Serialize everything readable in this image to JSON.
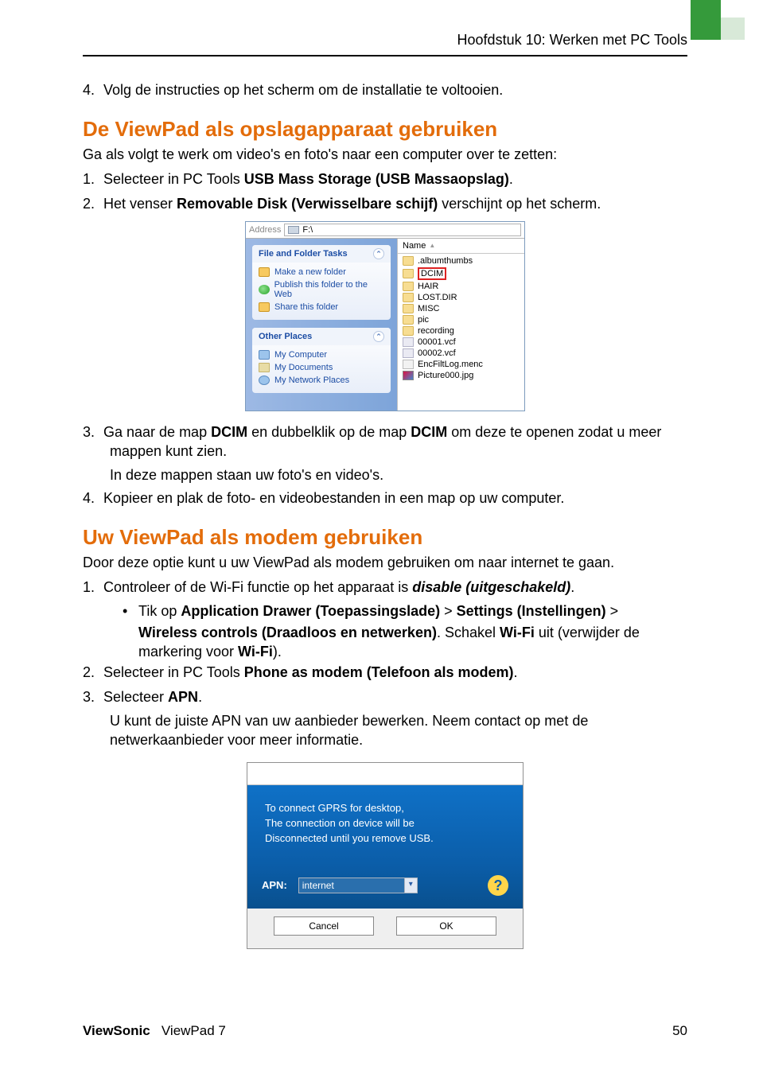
{
  "header": {
    "chapter": "Hoofdstuk 10: Werken met PC Tools"
  },
  "intro_step4": {
    "num": "4.",
    "text": "Volg de instructies op het scherm om de installatie te voltooien."
  },
  "sec1": {
    "title": "De ViewPad als opslagapparaat gebruiken",
    "lead": "Ga als volgt te werk om video's en foto's naar een computer over te zetten:",
    "step1": {
      "num": "1.",
      "pre": "Selecteer in PC Tools ",
      "bold": "USB Mass Storage (USB Massaopslag)",
      "post": "."
    },
    "step2": {
      "num": "2.",
      "pre": "Het venser ",
      "bold": "Removable Disk (Verwisselbare schijf)",
      "post": " verschijnt op het scherm."
    },
    "step3": {
      "num": "3.",
      "line_a": "Ga naar de map ",
      "b1": "DCIM",
      "mid": " en dubbelklik op de map ",
      "b2": "DCIM",
      "line_b": " om deze te openen zodat u meer mappen kunt zien.",
      "sub": "In deze mappen staan uw foto's en video's."
    },
    "step4": {
      "num": "4.",
      "text": "Kopieer en plak de foto- en videobestanden in een map op uw computer."
    }
  },
  "explorer": {
    "address_label": "Address",
    "drive": "F:\\",
    "tasks_title": "File and Folder Tasks",
    "tasks": [
      "Make a new folder",
      "Publish this folder to the Web",
      "Share this folder"
    ],
    "places_title": "Other Places",
    "places": [
      "My Computer",
      "My Documents",
      "My Network Places"
    ],
    "name_col": "Name",
    "files": [
      ".albumthumbs",
      "DCIM",
      "HAIR",
      "LOST.DIR",
      "MISC",
      "pic",
      "recording",
      "00001.vcf",
      "00002.vcf",
      "EncFiltLog.menc",
      "Picture000.jpg"
    ]
  },
  "sec2": {
    "title": "Uw ViewPad als modem gebruiken",
    "lead": "Door deze optie kunt u uw ViewPad als modem gebruiken om naar internet te gaan.",
    "step1": {
      "num": "1.",
      "line": "Controleer of de Wi-Fi functie op het apparaat is ",
      "disable": "disable (uitgeschakeld)",
      "post": ".",
      "b_pre": "Tik op ",
      "b_appdrawer": "Application Drawer (Toepassingslade)",
      "b_gt1": " > ",
      "b_settings": "Settings (Instellingen)",
      "b_gt2": " > ",
      "b_wireless": "Wireless controls (Draadloos en netwerken)",
      "b_mid": ". Schakel ",
      "b_wifi": "Wi-Fi",
      "b_mid2": " uit (verwijder de markering voor ",
      "b_wifi2": "Wi-Fi",
      "b_end": ")."
    },
    "step2": {
      "num": "2.",
      "pre": "Selecteer in PC Tools ",
      "bold": "Phone as modem (Telefoon als modem)",
      "post": "."
    },
    "step3": {
      "num": "3.",
      "pre": "Selecteer ",
      "bold": "APN",
      "post": ".",
      "sub": "U kunt de juiste APN van uw aanbieder bewerken. Neem contact op met de netwerkaanbieder voor meer informatie."
    }
  },
  "dialog": {
    "line1": "To connect GPRS for desktop,",
    "line2": "The connection on device will be",
    "line3": "Disconnected until you remove USB.",
    "apn_label": "APN:",
    "apn_value": "internet",
    "help": "?",
    "cancel": "Cancel",
    "ok": "OK"
  },
  "footer": {
    "brand": "ViewSonic",
    "product": "ViewPad 7",
    "page": "50"
  }
}
